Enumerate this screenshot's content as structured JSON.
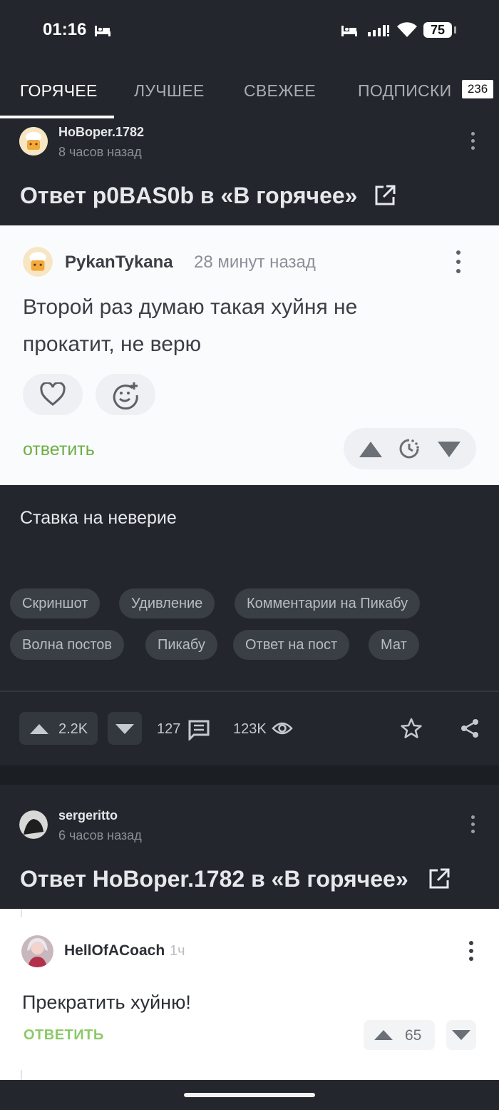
{
  "status": {
    "time": "01:16",
    "battery": "75"
  },
  "tabs": {
    "hot": "ГОРЯЧЕЕ",
    "best": "ЛУЧШЕЕ",
    "fresh": "СВЕЖЕЕ",
    "subs": "ПОДПИСКИ",
    "subs_count": "236"
  },
  "post1": {
    "author": "НоВoper.1782",
    "time": "8 часов назад",
    "title": "Ответ p0BAS0b в «В горячее»",
    "comment": {
      "author": "PykanTykana",
      "time": "28 минут назад",
      "text": "Второй раз думаю такая хуйня не прокатит, не верю",
      "reply": "ответить"
    },
    "body_text": "Ставка на неверие",
    "tags": [
      "Скриншот",
      "Удивление",
      "Комментарии на Пикабу",
      "Волна постов",
      "Пикабу",
      "Ответ на пост",
      "Мат"
    ],
    "rating": "2.2K",
    "comments_count": "127",
    "views": "123K"
  },
  "post2": {
    "author": "sergeritto",
    "time": "6 часов назад",
    "title": "Ответ НоВoper.1782 в «В горячее»",
    "comment": {
      "author": "HellOfACoach",
      "time": "1ч",
      "text": "Прекратить хуйню!",
      "reply": "ОТВЕТИТЬ",
      "rating": "65"
    }
  },
  "colors": {
    "accent_green": "#6cae45",
    "background": "#23272d",
    "card": "#fafbfd"
  }
}
